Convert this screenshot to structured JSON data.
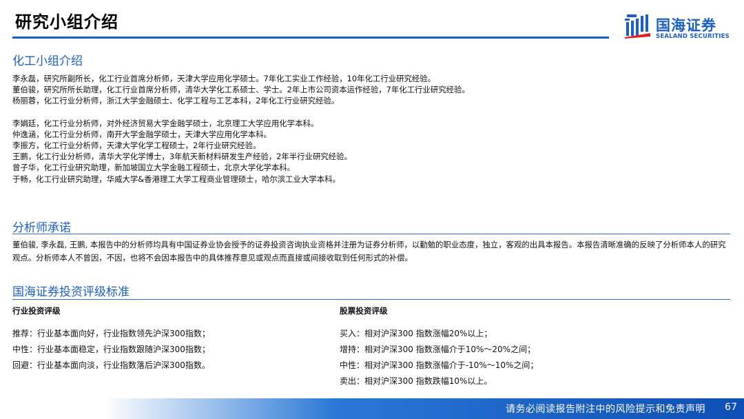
{
  "header": {
    "title": "研究小组介绍",
    "logo_cn": "国海证券",
    "logo_en": "SEALAND SECURITIES",
    "accent": "#1a5fc9"
  },
  "team": {
    "heading": "化工小组介绍",
    "group1": [
      "李永磊，研究所副所长，化工行业首席分析师，天津大学应用化学硕士。7年化工实业工作经验，10年化工行业研究经验。",
      "董伯骏，研究所所长助理，化工行业首席分析师，清华大学化工系硕士、学士。2年上市公司资本运作经验，7年化工行业研究经验。",
      "杨丽蓉，化工行业分析师，浙江大学金融硕士、化学工程与工艺本科，2年化工行业研究经验。"
    ],
    "group2": [
      "李娟廷，化工行业分析师，对外经济贸易大学金融学硕士，北京理工大学应用化学本科。",
      "仲逸涵，化工行业分析师，南开大学金融学硕士，天津大学应用化学本科。",
      "李振方，化工行业分析师，天津大学化学工程硕士，2年行业研究经验。",
      "王鹏，化工行业分析师，清华大学化学博士，3年航天新材料研发生产经验，2年半行业研究经验。",
      "曾子华，化工行业研究助理，新加坡国立大学金融工程硕士，北京大学化学本科。",
      "于畅，化工行业研究助理，华威大学&香港理工大学工程商业管理硕士，哈尔滨工业大学本科。"
    ]
  },
  "pledge": {
    "heading": "分析师承诺",
    "text": "董伯骏, 李永磊, 王鹏, 本报告中的分析师均具有中国证券业协会授予的证券投资咨询执业资格并注册为证券分析师，以勤勉的职业态度，独立，客观的出具本报告。本报告清晰准确的反映了分析师本人的研究观点。分析师本人不曾因，不因，也将不会因本报告中的具体推荐意见或观点而直接或间接收取到任何形式的补偿。"
  },
  "rating": {
    "heading": "国海证券投资评级标准",
    "industry": {
      "title": "行业投资评级",
      "items": [
        "推荐：行业基本面向好，行业指数领先沪深300指数；",
        "中性：行业基本面稳定，行业指数跟随沪深300指数；",
        "回避：行业基本面向淡，行业指数落后沪深300指数。"
      ]
    },
    "stock": {
      "title": "股票投资评级",
      "items": [
        "买入：相对沪深300 指数涨幅20%以上；",
        "增持：相对沪深300 指数涨幅介于10%～20%之间；",
        "中性：相对沪深300 指数涨幅介于-10%～10%之间；",
        "卖出：相对沪深300 指数跌幅10%以上。"
      ]
    }
  },
  "footer": {
    "disclaimer": "请务必阅读报告附注中的风险提示和免责声明",
    "page": "67"
  }
}
